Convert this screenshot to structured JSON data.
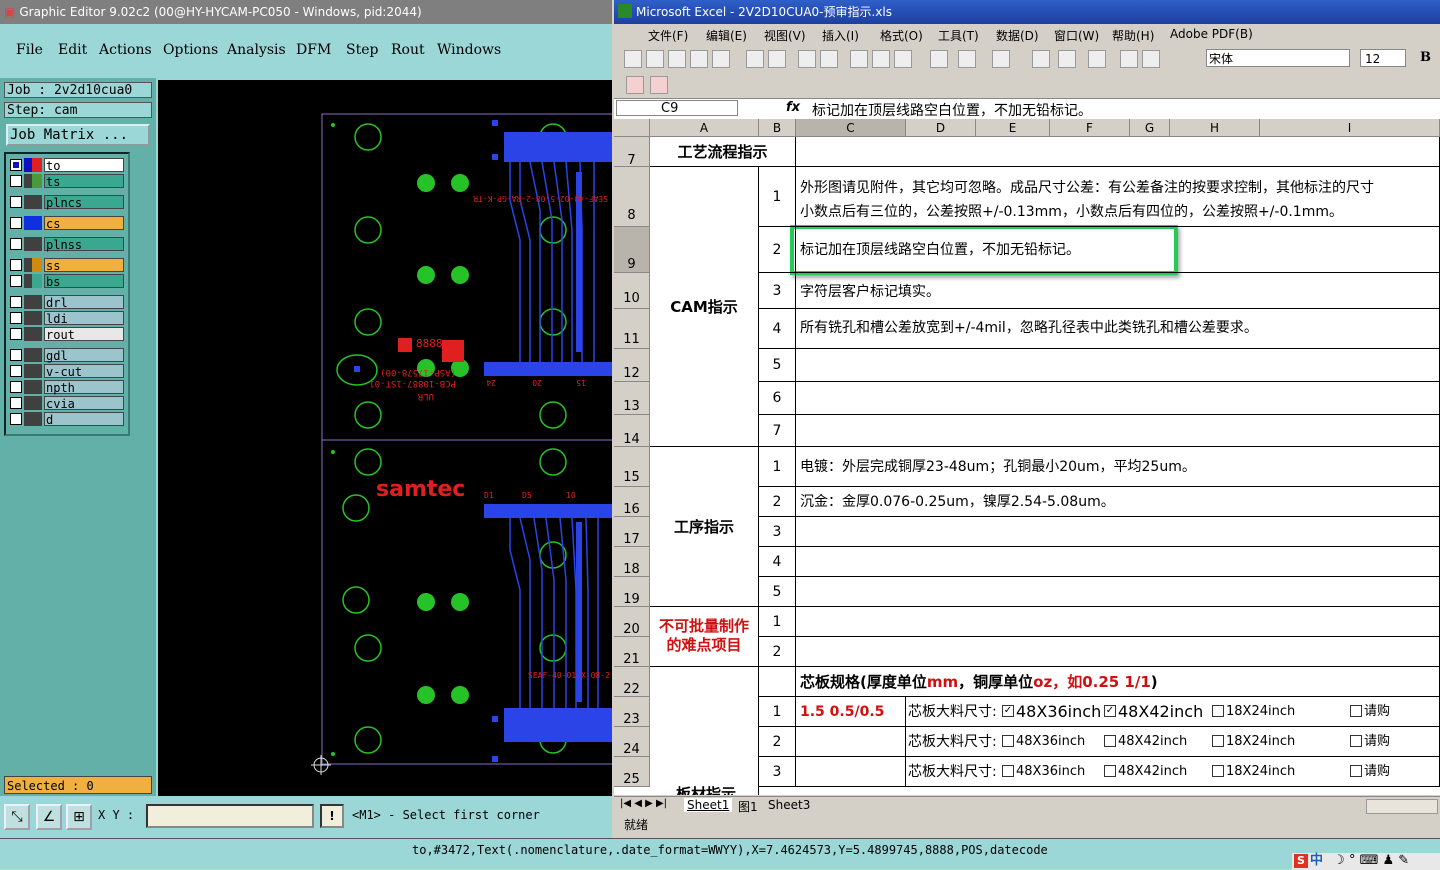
{
  "ge": {
    "title": "Graphic Editor 9.02c2 (00@HY-HYCAM-PC050 - Windows, pid:2044)",
    "menu": [
      "File",
      "Edit",
      "Actions",
      "Options",
      "Analysis",
      "DFM",
      "Step",
      "Rout",
      "Windows"
    ],
    "job": "Job : 2v2d10cua0",
    "step": "Step: cam",
    "job_matrix": "Job Matrix ...",
    "layers": [
      {
        "name": "to",
        "box": "#ffffff"
      },
      {
        "name": "ts",
        "box": "#3aa890"
      },
      {
        "name": "plncs",
        "box": "#3aa890"
      },
      {
        "name": "cs",
        "box": "#f0b040"
      },
      {
        "name": "plnss",
        "box": "#3aa890"
      },
      {
        "name": "ss",
        "box": "#f0b040"
      },
      {
        "name": "bs",
        "box": "#3aa890"
      },
      {
        "name": "drl",
        "box": "#9cc4cc"
      },
      {
        "name": "ldi",
        "box": "#9cc4cc"
      },
      {
        "name": "rout",
        "box": "#e8e8e8"
      },
      {
        "name": "gdl",
        "box": "#9cc4cc"
      },
      {
        "name": "v-cut",
        "box": "#9cc4cc"
      },
      {
        "name": "npth",
        "box": "#9cc4cc"
      },
      {
        "name": "cvia",
        "box": "#9cc4cc"
      },
      {
        "name": "d",
        "box": "#9cc4cc"
      }
    ],
    "selected": "Selected : 0",
    "xy_label": "X Y :",
    "prompt": "<M1> - Select first corner",
    "canvas_texts": {
      "logo": "samtec",
      "num_8888": "8888",
      "pcb_label": "PCB-10887-1ST-01",
      "asp_label": "(ASP-17578-00)",
      "ulr": "ULR",
      "conn_top": "SEAF-40-02-5-08-2-RA-GP-K-TR",
      "conn_bot": "SEAF-40-01-X-08-2",
      "pin_24": "24",
      "pin_20": "20",
      "pin_15": "15",
      "pin_d1": "D1",
      "pin_d5": "D5",
      "pin_10": "10"
    }
  },
  "xl": {
    "title": "Microsoft Excel - 2V2D10CUA0-预审指示.xls",
    "menu": [
      "文件(F)",
      "编辑(E)",
      "视图(V)",
      "插入(I)",
      "格式(O)",
      "工具(T)",
      "数据(D)",
      "窗口(W)",
      "帮助(H)",
      "Adobe PDF(B)"
    ],
    "font_name": "宋体",
    "font_size": "12",
    "bold": "B",
    "name_box": "C9",
    "fx": "fx",
    "formula": "标记加在顶层线路空白位置，不加无铅标记。",
    "columns": [
      "A",
      "B",
      "C",
      "D",
      "E",
      "F",
      "G",
      "H",
      "I"
    ],
    "rows": [
      "7",
      "8",
      "9",
      "10",
      "11",
      "12",
      "13",
      "14",
      "15",
      "16",
      "17",
      "18",
      "19",
      "20",
      "21",
      "22",
      "23",
      "24",
      "25"
    ],
    "sections": {
      "process": "工艺流程指示",
      "cam": "CAM指示",
      "procedure": "工序指示",
      "difficult_1": "不可批量制作",
      "difficult_2": "的难点项目",
      "material_partial": "板材指示"
    },
    "cam_items": [
      {
        "n": "1",
        "text1": "外形图请见附件，其它均可忽略。成品尺寸公差：有公差备注的按要求控制，其他标注的尺寸",
        "text2": "小数点后有三位的，公差按照+/-0.13mm，小数点后有四位的，公差按照+/-0.1mm。"
      },
      {
        "n": "2",
        "text1": "标记加在顶层线路空白位置，不加无铅标记。"
      },
      {
        "n": "3",
        "text1": "字符层客户标记填实。"
      },
      {
        "n": "4",
        "text1": "所有铣孔和槽公差放宽到+/-4mil，忽略孔径表中此类铣孔和槽公差要求。"
      },
      {
        "n": "5"
      },
      {
        "n": "6"
      },
      {
        "n": "7"
      }
    ],
    "proc_items": [
      {
        "n": "1",
        "text": "电镀：外层完成铜厚23-48um；孔铜最小20um，平均25um。"
      },
      {
        "n": "2",
        "text": "沉金：金厚0.076-0.25um，镍厚2.54-5.08um。"
      },
      {
        "n": "3"
      },
      {
        "n": "4"
      },
      {
        "n": "5"
      }
    ],
    "diff_items": [
      "1",
      "2"
    ],
    "core_header_a": "芯板规格(厚度单位",
    "core_header_mm": "mm",
    "core_header_b": "，铜厚单位",
    "core_header_oz": "oz",
    "core_header_c": "，如0.25 1/1",
    "core_header_d": ")",
    "core_rows": [
      {
        "n": "1",
        "spec": "1.5 0.5/0.5",
        "label": "芯板大料尺寸:",
        "o1": "48X36inch",
        "o2": "48X42inch",
        "o3": "18X24inch",
        "o4": "请购",
        "c1": true,
        "c2": true
      },
      {
        "n": "2",
        "spec": "",
        "label": "芯板大料尺寸:",
        "o1": "48X36inch",
        "o2": "48X42inch",
        "o3": "18X24inch",
        "o4": "请购",
        "c1": false,
        "c2": false
      },
      {
        "n": "3",
        "spec": "",
        "label": "芯板大料尺寸:",
        "o1": "48X36inch",
        "o2": "48X42inch",
        "o3": "18X24inch",
        "o4": "请购",
        "c1": false,
        "c2": false
      }
    ],
    "sheets": [
      "Sheet1",
      "图1",
      "Sheet3"
    ],
    "status": "就绪"
  },
  "status_bar": "to,#3472,Text(.nomenclature,.date_format=WWYY),X=7.4624573,Y=5.4899745,8888,POS,datecode",
  "ime": {
    "s": "S",
    "lang": "中"
  },
  "colors": {
    "highlight": "#22cc55",
    "ge_bg": "#9cd7d7",
    "accent_red": "#d01010"
  }
}
